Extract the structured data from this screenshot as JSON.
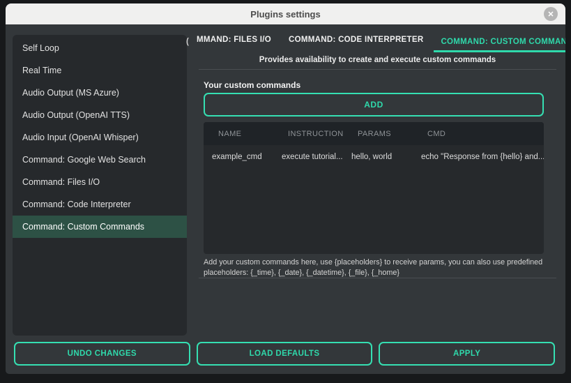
{
  "window": {
    "title": "Plugins settings",
    "close_icon": "✕"
  },
  "colors": {
    "accent": "#35dfb2",
    "active_tab_text": "#2fd9ab",
    "selected_item_bg": "#2d5145",
    "dialog_bg": "#33373a",
    "sidebar_bg": "#26292c",
    "table_header_bg": "#1f2327",
    "titlebar_bg": "#f0f0ef"
  },
  "sidebar": {
    "items": [
      {
        "label": "Self Loop"
      },
      {
        "label": "Real Time"
      },
      {
        "label": "Audio Output (MS Azure)"
      },
      {
        "label": "Audio Output (OpenAI TTS)"
      },
      {
        "label": "Audio Input (OpenAI Whisper)"
      },
      {
        "label": "Command: Google Web Search"
      },
      {
        "label": "Command: Files I/O"
      },
      {
        "label": "Command: Code Interpreter"
      },
      {
        "label": "Command: Custom Commands"
      }
    ],
    "selected_index": 8
  },
  "tabs": {
    "clipped_fragment": "(",
    "items": [
      {
        "label": "MMAND: FILES I/O"
      },
      {
        "label": "COMMAND: CODE INTERPRETER"
      },
      {
        "label": "COMMAND: CUSTOM COMMANDS"
      }
    ],
    "active_index": 2,
    "scroll_left_icon": "❮",
    "scroll_right_icon": "❯",
    "description": "Provides availability to create and execute custom commands"
  },
  "content": {
    "section_label": "Your custom commands",
    "add_button_label": "ADD",
    "table": {
      "columns": [
        "NAME",
        "INSTRUCTION",
        "PARAMS",
        "CMD"
      ],
      "rows": [
        {
          "name": "example_cmd",
          "instruction": "execute tutorial...",
          "params": "hello, world",
          "cmd": "echo \"Response from {hello} and..."
        }
      ]
    },
    "help_text": "Add your custom commands here, use {placeholders} to receive params, you can also use predefined placeholders: {_time}, {_date}, {_datetime}, {_file}, {_home}"
  },
  "footer": {
    "undo_label": "UNDO CHANGES",
    "defaults_label": "LOAD DEFAULTS",
    "apply_label": "APPLY"
  }
}
